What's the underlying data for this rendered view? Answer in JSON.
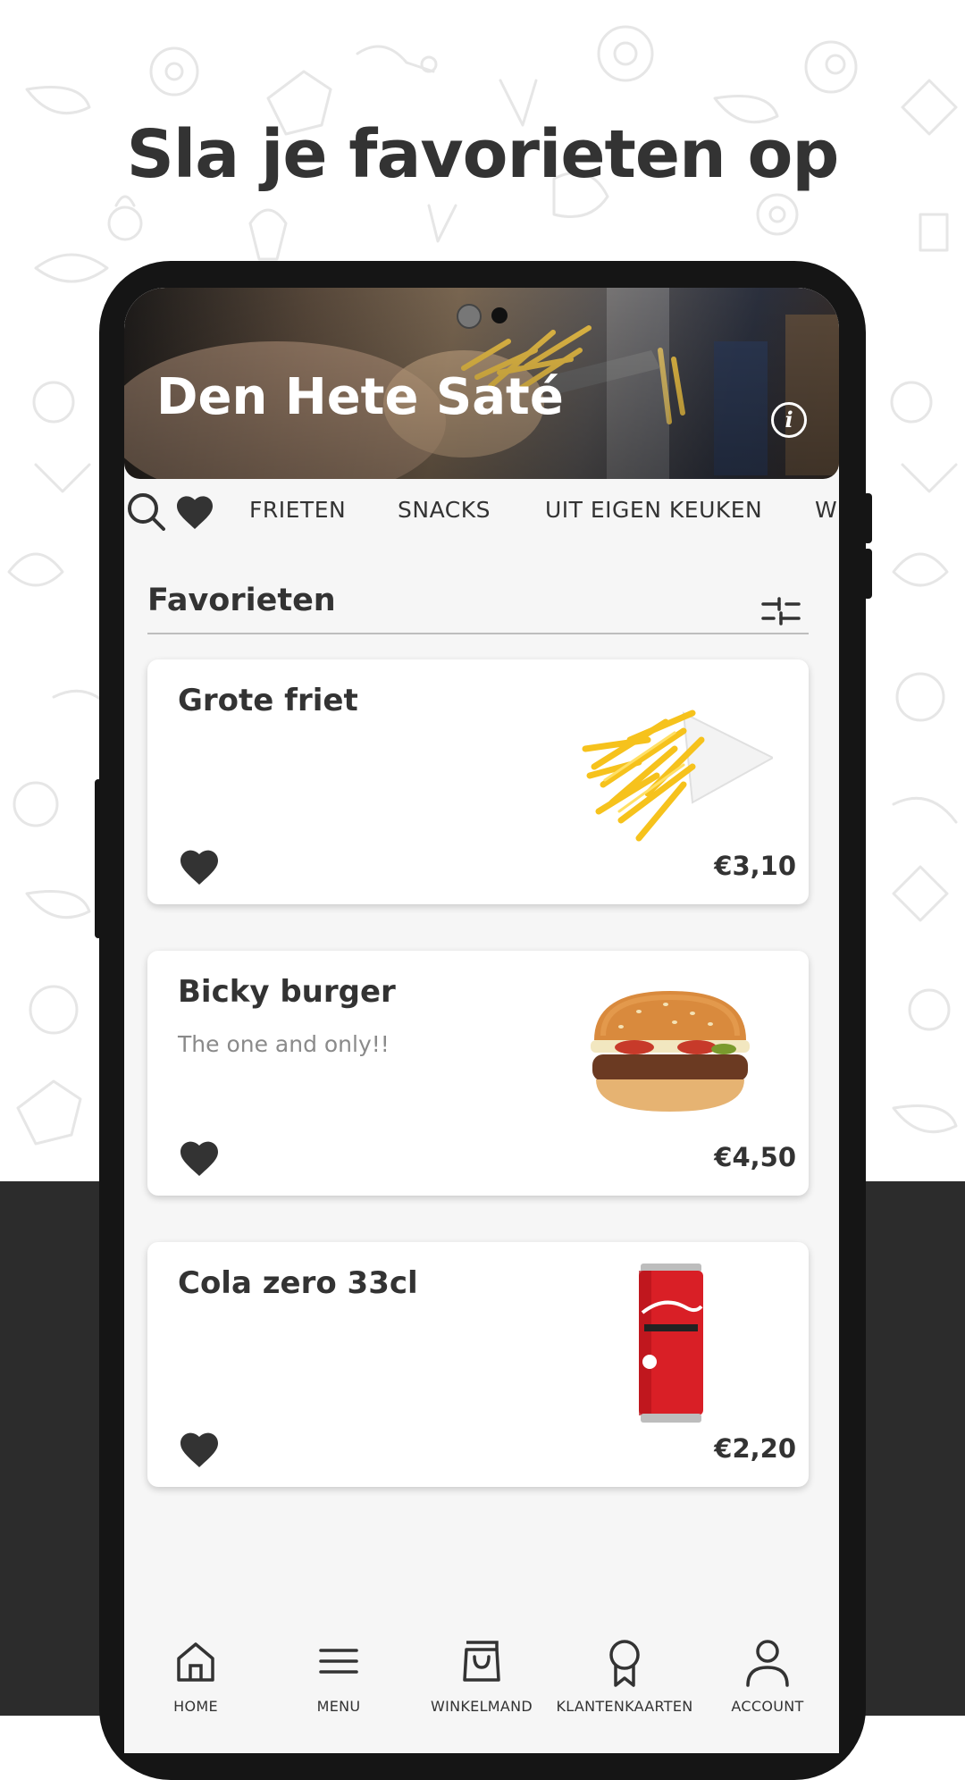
{
  "promo": {
    "title": "Sla je favorieten op"
  },
  "restaurant": {
    "name": "Den Hete Saté",
    "info_icon": "info-icon"
  },
  "tabs": {
    "search_icon": "search-icon",
    "favorites_icon": "heart-icon",
    "items": [
      "FRIETEN",
      "SNACKS",
      "UIT EIGEN KEUKEN",
      "W"
    ]
  },
  "section": {
    "title": "Favorieten",
    "filter_icon": "sliders-icon"
  },
  "products": [
    {
      "name": "Grote friet",
      "description": "",
      "price": "€3,10",
      "favorite": true,
      "image": "fries"
    },
    {
      "name": "Bicky burger",
      "description": "The one and only!!",
      "price": "€4,50",
      "favorite": true,
      "image": "burger"
    },
    {
      "name": "Cola zero 33cl",
      "description": "",
      "price": "€2,20",
      "favorite": true,
      "image": "cola-can"
    }
  ],
  "bottom_nav": [
    {
      "label": "HOME",
      "icon": "home-icon"
    },
    {
      "label": "MENU",
      "icon": "menu-icon"
    },
    {
      "label": "WINKELMAND",
      "icon": "shopping-bag-icon"
    },
    {
      "label": "KLANTENKAARTEN",
      "icon": "award-icon"
    },
    {
      "label": "ACCOUNT",
      "icon": "account-icon"
    }
  ],
  "colors": {
    "accent": "#333333",
    "dark_background": "#2c2c2c",
    "screen_background": "#f6f6f6",
    "phone_frame": "#151515"
  }
}
